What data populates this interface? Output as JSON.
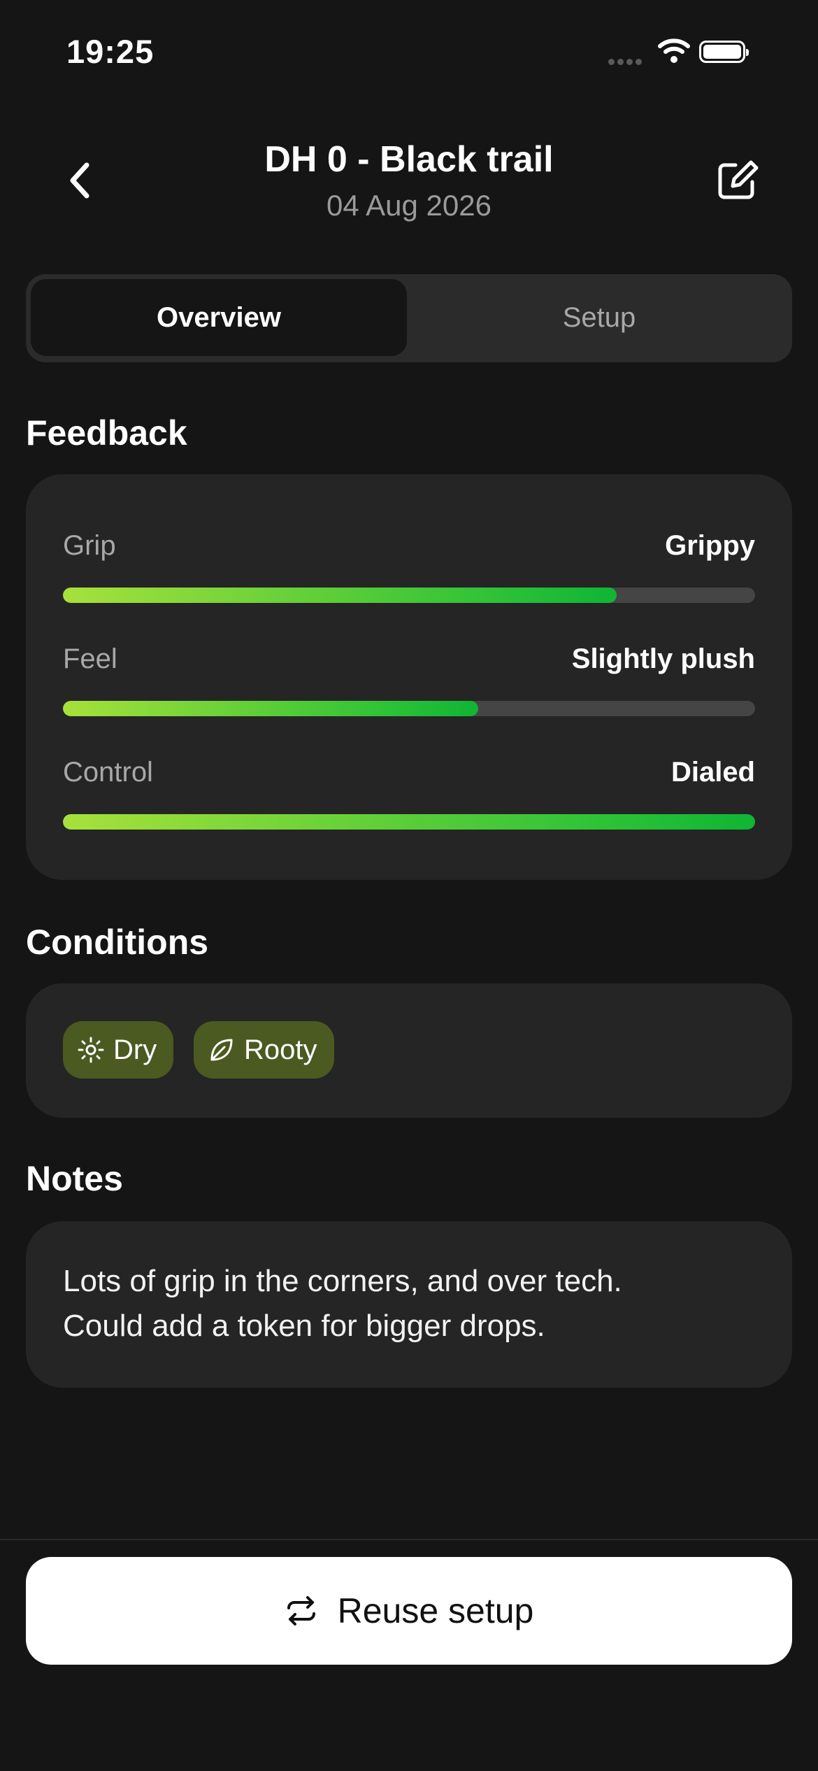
{
  "status_bar": {
    "time": "19:25"
  },
  "header": {
    "title": "DH 0 - Black trail",
    "date": "04 Aug 2026"
  },
  "tabs": [
    {
      "label": "Overview",
      "active": true
    },
    {
      "label": "Setup",
      "active": false
    }
  ],
  "feedback": {
    "heading": "Feedback",
    "items": [
      {
        "label": "Grip",
        "value": "Grippy",
        "level": 0.8
      },
      {
        "label": "Feel",
        "value": "Slightly plush",
        "level": 0.6
      },
      {
        "label": "Control",
        "value": "Dialed",
        "level": 1.0
      }
    ]
  },
  "conditions": {
    "heading": "Conditions",
    "chips": [
      {
        "label": "Dry",
        "icon": "sun-icon"
      },
      {
        "label": "Rooty",
        "icon": "leaf-icon"
      }
    ]
  },
  "notes": {
    "heading": "Notes",
    "lines": [
      "Lots of grip in the corners, and over tech.",
      "Could add a token for bigger drops."
    ]
  },
  "actions": {
    "reuse_label": "Reuse setup",
    "reuse_icon": "repeat-icon"
  },
  "colors": {
    "background": "#151515",
    "card": "#252525",
    "chip": "#4b5a20",
    "bar_start": "#a7e13b",
    "bar_end": "#0fb534",
    "track": "#454545"
  }
}
